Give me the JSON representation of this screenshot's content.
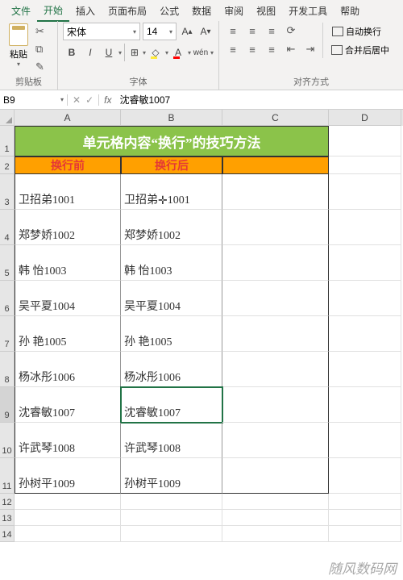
{
  "menu": {
    "file": "文件",
    "home": "开始",
    "insert": "插入",
    "layout": "页面布局",
    "formula": "公式",
    "data": "数据",
    "review": "审阅",
    "view": "视图",
    "dev": "开发工具",
    "help": "帮助"
  },
  "ribbon": {
    "clipboard": {
      "paste": "粘贴",
      "label": "剪贴板"
    },
    "font": {
      "name": "宋体",
      "size": "14",
      "label": "字体",
      "bold": "B",
      "italic": "I",
      "underline": "U",
      "wen": "wén"
    },
    "align": {
      "label": "对齐方式",
      "wrap": "自动换行",
      "merge": "合并后居中"
    }
  },
  "fx": {
    "name": "B9",
    "formula": "沈睿敏1007"
  },
  "cols": {
    "A": "A",
    "B": "B",
    "C": "C",
    "D": "D"
  },
  "title": "单元格内容“换行”的技巧方法",
  "headers": {
    "a": "换行前",
    "b": "换行后"
  },
  "rows": [
    {
      "n": "3",
      "a": "卫招弟1001",
      "b": "卫招弟1001",
      "cur": true
    },
    {
      "n": "4",
      "a": "郑梦娇1002",
      "b": "郑梦娇1002"
    },
    {
      "n": "5",
      "a": "韩   怡1003",
      "b": "韩   怡1003"
    },
    {
      "n": "6",
      "a": "吴平夏1004",
      "b": "吴平夏1004"
    },
    {
      "n": "7",
      "a": "孙   艳1005",
      "b": "孙   艳1005"
    },
    {
      "n": "8",
      "a": "杨冰彤1006",
      "b": "杨冰彤1006"
    },
    {
      "n": "9",
      "a": "沈睿敏1007",
      "b": "沈睿敏1007",
      "sel": true
    },
    {
      "n": "10",
      "a": "许武琴1008",
      "b": "许武琴1008"
    },
    {
      "n": "11",
      "a": "孙树平1009",
      "b": "孙树平1009"
    }
  ],
  "emptyRows": [
    "12",
    "13",
    "14"
  ],
  "watermark": "随风数码网"
}
